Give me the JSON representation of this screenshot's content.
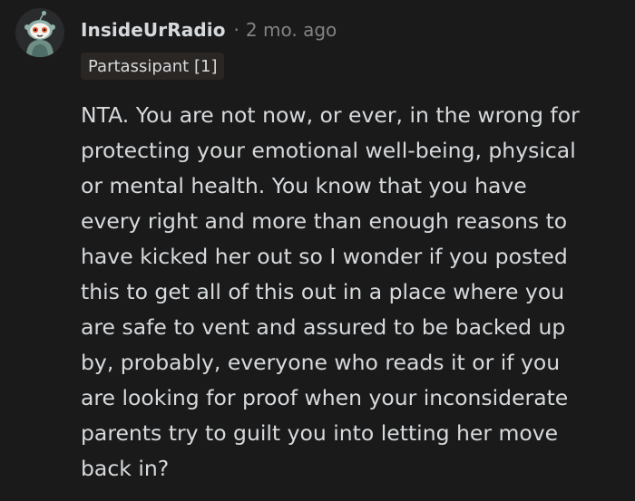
{
  "comment": {
    "username": "InsideUrRadio",
    "separator": "·",
    "timestamp": "2 mo. ago",
    "flair": "Partassipant [1]",
    "body_lines": [
      "NTA. You are not now, or ever, in the wrong for",
      "protecting your emotional well-being, physical",
      "or mental health. You know that you have",
      "every right and more than enough reasons to",
      "have kicked her out so I wonder if you posted",
      "this to get all of this out in a place where you",
      "are safe to vent and assured to be backed up",
      "by, probably, everyone who reads it or if you",
      "are looking for proof when your inconsiderate",
      "parents try to guilt you into letting her move",
      "back in?"
    ]
  },
  "colors": {
    "background": "#1a1a1b",
    "text": "#d7dadc",
    "meta": "#818384",
    "flair_bg": "#2a2624"
  },
  "icons": {
    "avatar": "snoo-avatar-icon"
  }
}
